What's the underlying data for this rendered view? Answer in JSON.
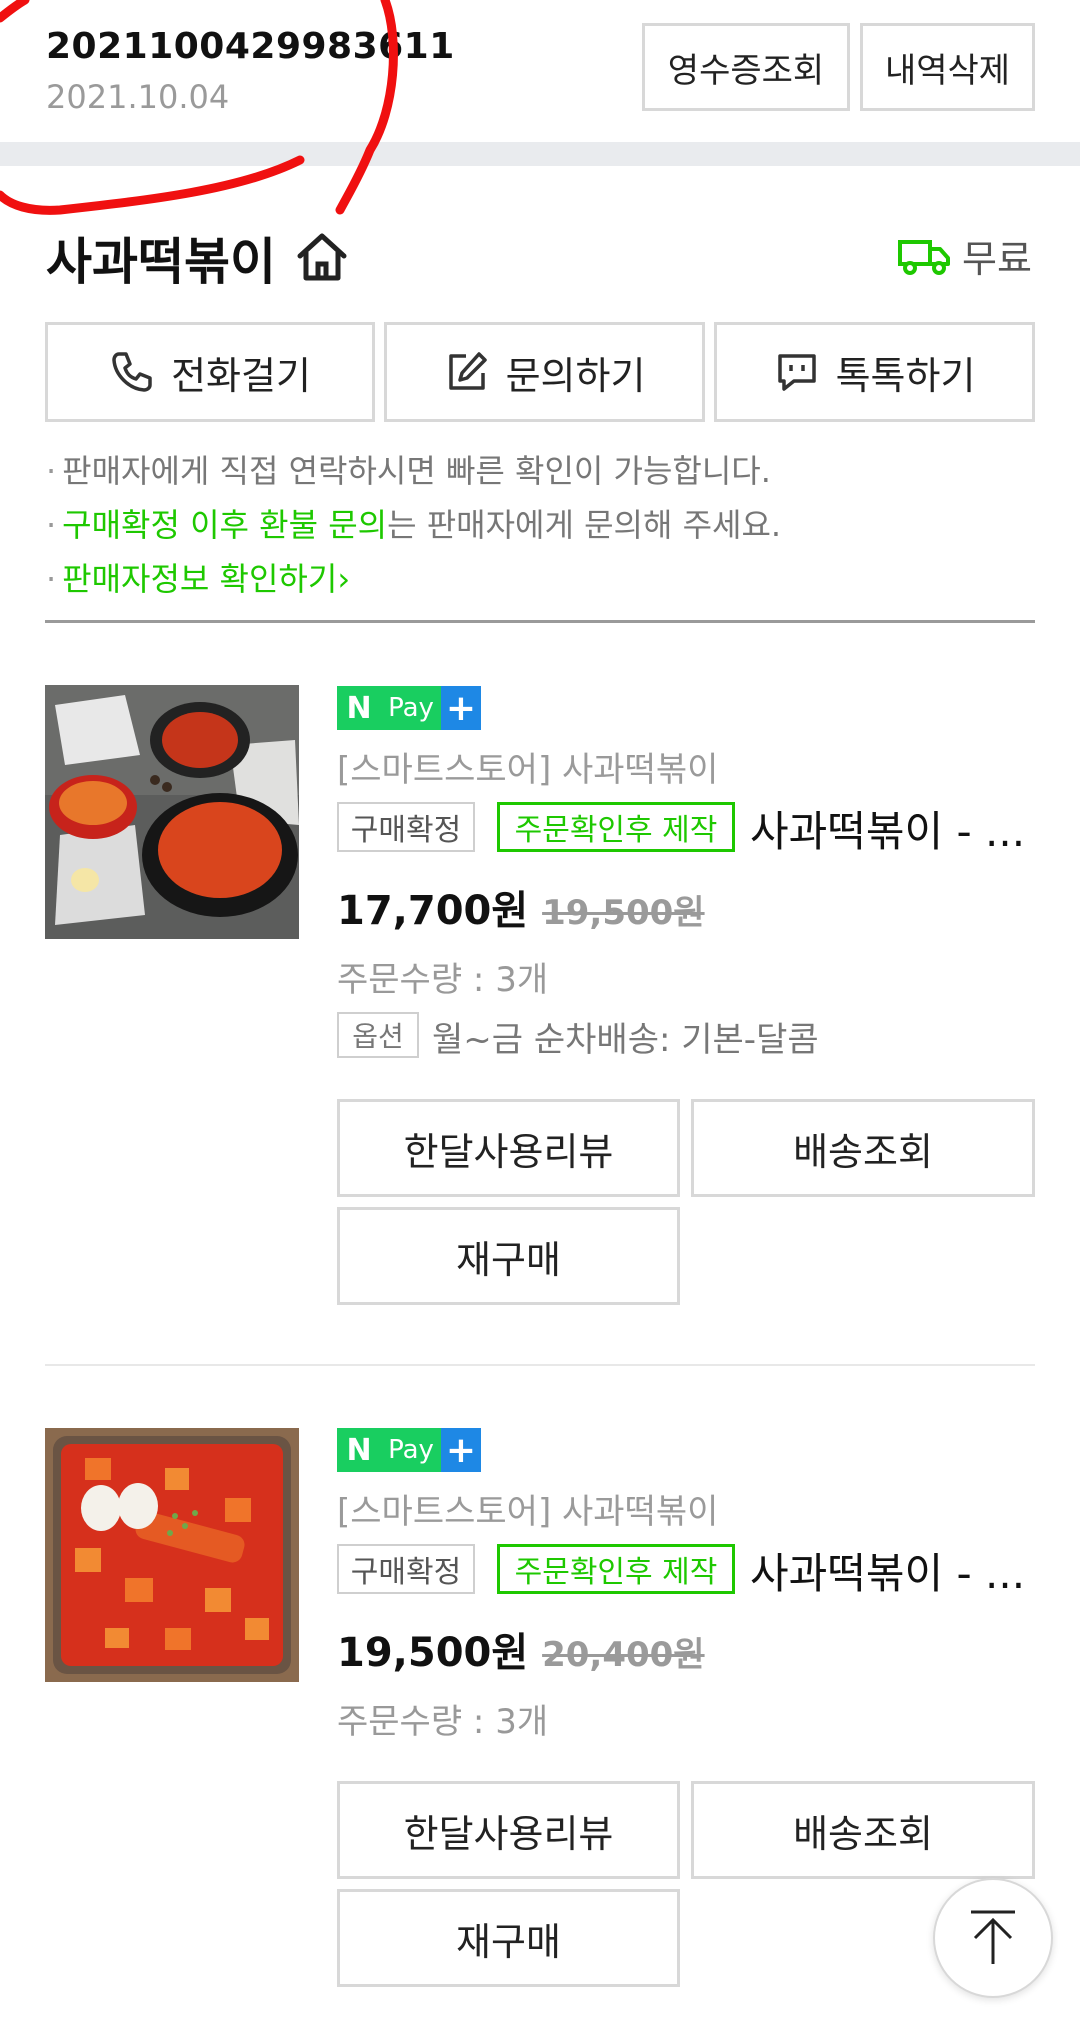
{
  "header": {
    "order_number": "2021100429983611",
    "order_date": "2021.10.04",
    "receipt_button": "영수증조회",
    "delete_button": "내역삭제"
  },
  "store": {
    "name": "사과떡볶이",
    "shipping_fee": "무료",
    "call_button": "전화걸기",
    "inquiry_button": "문의하기",
    "talk_button": "톡톡하기",
    "notes": {
      "line1": "판매자에게 직접 연락하시면 빠른 확인이 가능합니다.",
      "line2_highlight": "구매확정 이후 환불 문의",
      "line2_rest": "는 판매자에게 문의해 주세요.",
      "line3": "판매자정보 확인하기"
    }
  },
  "products": [
    {
      "badge": {
        "n": "N",
        "pay": "Pay",
        "plus": "+"
      },
      "store_line": "[스마트스토어] 사과떡볶이",
      "status_tag": "구매확정",
      "made_tag": "주문확인후 제작",
      "name": "사과떡볶이 - ...",
      "price": "17,700원",
      "original_price": "19,500원",
      "quantity": "주문수량 : 3개",
      "option_label": "옵션",
      "option_value": "월~금 순차배송: 기본-달콤",
      "review_button": "한달사용리뷰",
      "tracking_button": "배송조회",
      "rebuy_button": "재구매"
    },
    {
      "badge": {
        "n": "N",
        "pay": "Pay",
        "plus": "+"
      },
      "store_line": "[스마트스토어] 사과떡볶이",
      "status_tag": "구매확정",
      "made_tag": "주문확인후 제작",
      "name": "사과떡볶이 - ...",
      "price": "19,500원",
      "original_price": "20,400원",
      "quantity": "주문수량 : 3개",
      "review_button": "한달사용리뷰",
      "tracking_button": "배송조회",
      "rebuy_button": "재구매"
    }
  ],
  "colors": {
    "accent_green": "#1ec800",
    "npay_green": "#19ce60",
    "npay_blue": "#1e88e5",
    "annotation_red": "#f01010"
  }
}
